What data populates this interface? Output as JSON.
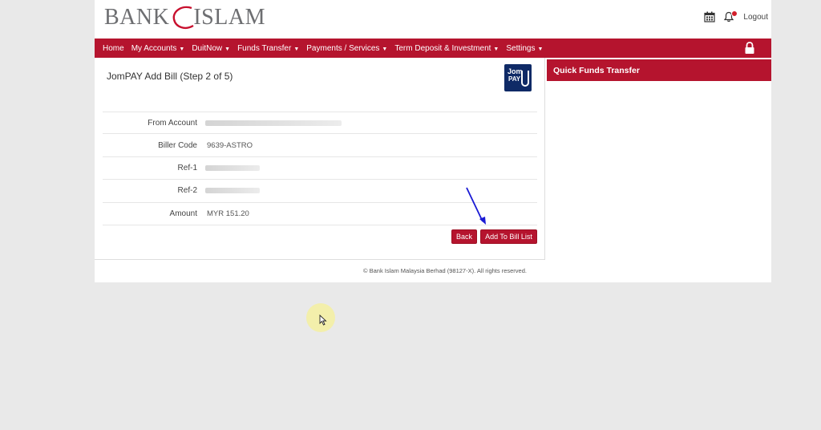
{
  "brand": {
    "part1": "BANK",
    "part2": "ISLAM"
  },
  "header": {
    "logout": "Logout"
  },
  "nav": {
    "items": [
      {
        "label": "Home",
        "dropdown": false
      },
      {
        "label": "My Accounts",
        "dropdown": true
      },
      {
        "label": "DuitNow",
        "dropdown": true
      },
      {
        "label": "Funds Transfer",
        "dropdown": true
      },
      {
        "label": "Payments / Services",
        "dropdown": true
      },
      {
        "label": "Term Deposit & Investment",
        "dropdown": true
      },
      {
        "label": "Settings",
        "dropdown": true
      }
    ]
  },
  "main": {
    "title": "JomPAY Add Bill (Step 2 of 5)",
    "jompay_logo": {
      "line1": "Jom",
      "line2": "PAY"
    },
    "fields": {
      "from_account": {
        "label": "From Account",
        "value": ""
      },
      "biller_code": {
        "label": "Biller Code",
        "value": "9639-ASTRO"
      },
      "ref1": {
        "label": "Ref-1",
        "value": ""
      },
      "ref2": {
        "label": "Ref-2",
        "value": ""
      },
      "amount": {
        "label": "Amount",
        "value": "MYR 151.20"
      }
    },
    "buttons": {
      "back": "Back",
      "add": "Add To Bill List"
    }
  },
  "side": {
    "title": "Quick Funds Transfer"
  },
  "footer": {
    "text": "© Bank Islam Malaysia Berhad (98127-X). All rights reserved."
  },
  "colors": {
    "brand_red": "#b5142e",
    "jompay_blue": "#0f2a66",
    "arrow_blue": "#1a1ad4"
  }
}
